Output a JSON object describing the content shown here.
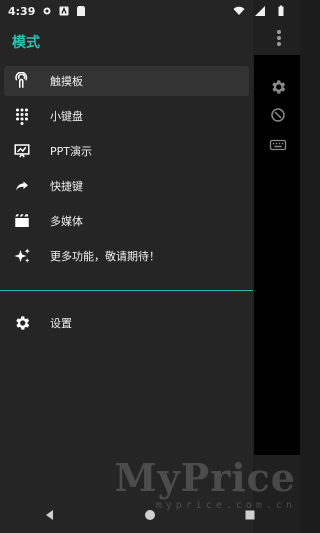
{
  "status_bar": {
    "time": "4:39"
  },
  "drawer": {
    "title": "模式",
    "items": [
      {
        "label": "触摸板",
        "icon": "touchpad-icon",
        "active": true
      },
      {
        "label": "小键盘",
        "icon": "keypad-icon",
        "active": false
      },
      {
        "label": "PPT演示",
        "icon": "presentation-icon",
        "active": false
      },
      {
        "label": "快捷键",
        "icon": "shortcut-icon",
        "active": false
      },
      {
        "label": "多媒体",
        "icon": "media-icon",
        "active": false
      },
      {
        "label": "更多功能，敬请期待！",
        "icon": "sparkle-icon",
        "active": false
      }
    ],
    "settings_label": "设置"
  },
  "watermark": {
    "main": "MyPrice",
    "sub": "myprice.com.cn"
  },
  "colors": {
    "accent": "#2fc0b4",
    "drawer_bg": "#252525",
    "active_bg": "#333333"
  }
}
